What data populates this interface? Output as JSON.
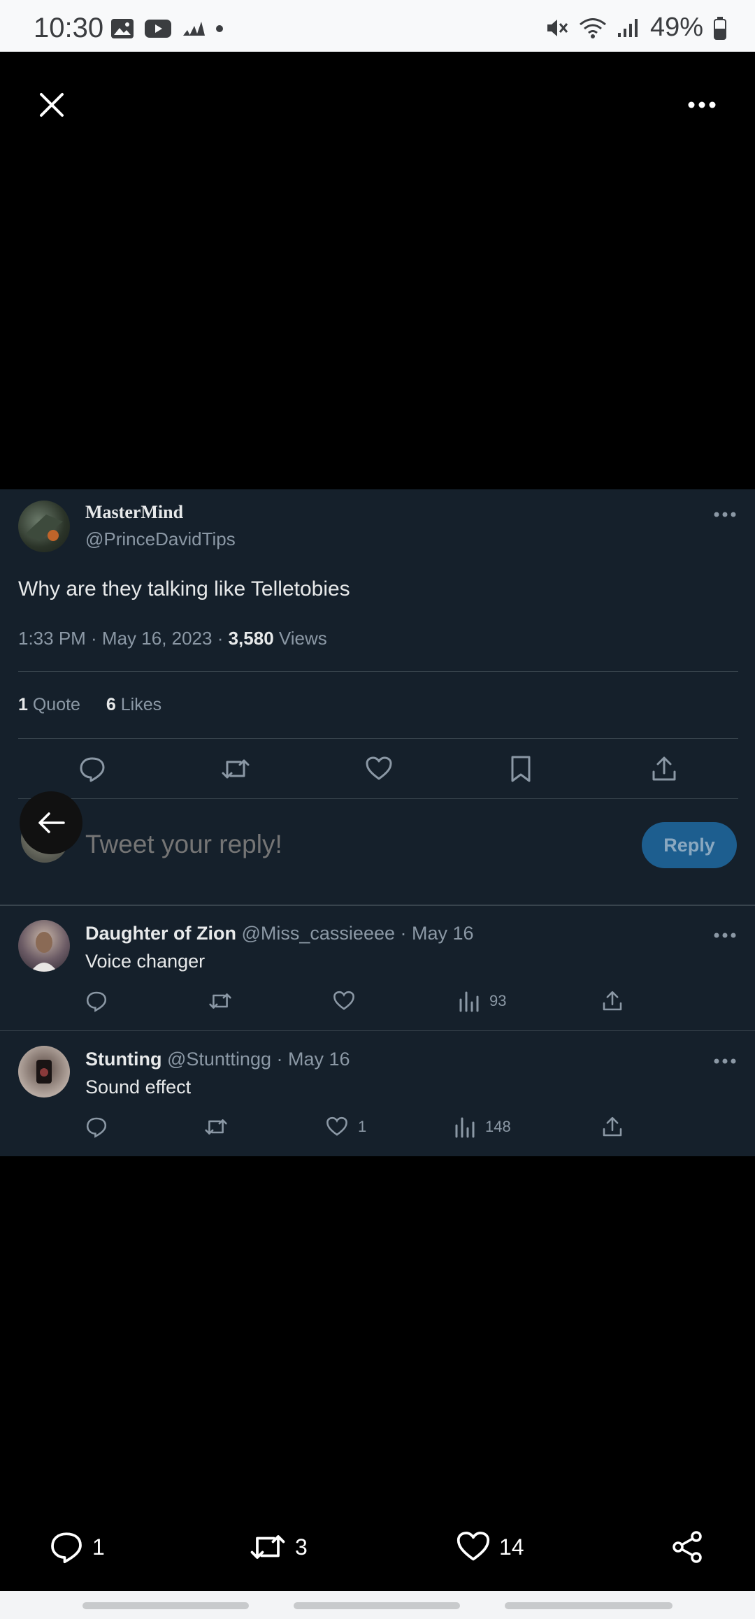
{
  "status_bar": {
    "time": "10:30",
    "battery": "49%"
  },
  "tweet": {
    "display_name": "MasterMind",
    "handle": "@PrinceDavidTips",
    "text": "Why are they talking like Telletobies",
    "timestamp": "1:33 PM · May 16, 2023 · ",
    "views_count": "3,580",
    "views_label": " Views",
    "quote_count": "1",
    "quote_label": " Quote",
    "likes_count": "6",
    "likes_label": " Likes"
  },
  "composer": {
    "placeholder": "Tweet your reply!",
    "reply_label": "Reply"
  },
  "replies": [
    {
      "name": "Daughter of Zion",
      "handle": "@Miss_cassieeee",
      "date": " · May 16",
      "text": "Voice changer",
      "likes": "",
      "views": "93"
    },
    {
      "name": "Stunting",
      "handle": "@Stunttingg",
      "date": " · May 16",
      "text": "Sound effect",
      "likes": "1",
      "views": "148"
    }
  ],
  "bottom_bar": {
    "replies": "1",
    "retweets": "3",
    "likes": "14"
  },
  "colors": {
    "card_bg": "#15202b",
    "accent": "#1d9bf0",
    "reply_button": "#1d5e8f"
  }
}
